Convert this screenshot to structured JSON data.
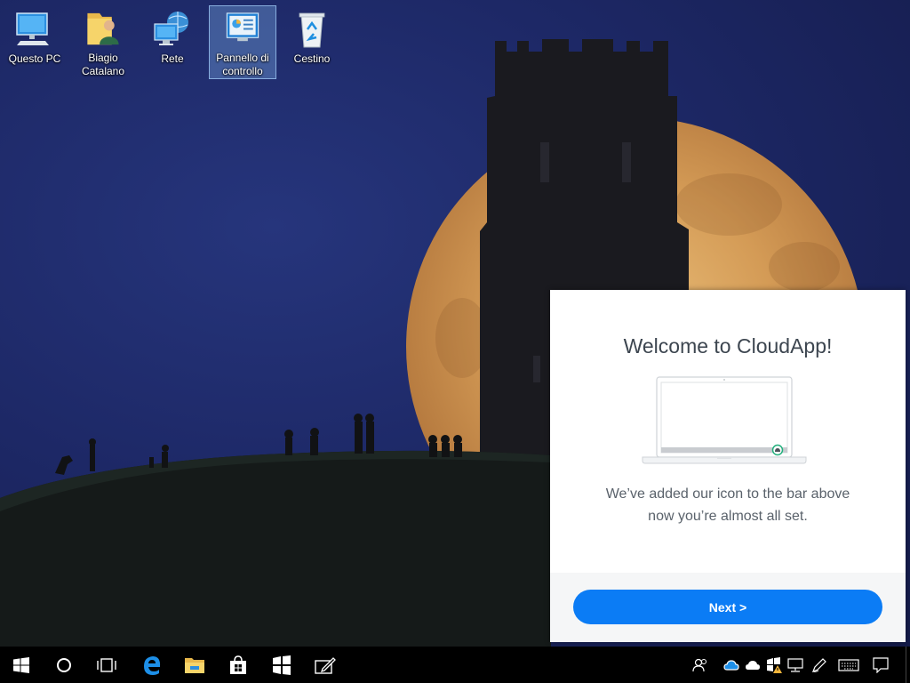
{
  "desktop": {
    "icons": [
      {
        "label": "Questo PC",
        "icon": "computer-icon"
      },
      {
        "label": "Biagio Catalano",
        "icon": "user-folder-icon"
      },
      {
        "label": "Rete",
        "icon": "network-icon"
      },
      {
        "label": "Pannello di controllo",
        "icon": "control-panel-icon",
        "selected": true
      },
      {
        "label": "Cestino",
        "icon": "recycle-bin-icon"
      }
    ]
  },
  "welcome": {
    "title": "Welcome to CloudApp!",
    "line1": "We’ve added our icon to the bar above",
    "line2": "now you’re almost all set.",
    "next_label": "Next >",
    "accent": "#0b7cf5"
  },
  "taskbar": {
    "buttons": [
      "start-icon",
      "cortana-icon",
      "task-view-icon",
      "edge-icon",
      "file-explorer-icon",
      "store-icon",
      "windows-app-icon",
      "sketch-icon"
    ],
    "tray": [
      "people-icon",
      "cloudapp-tray-icon",
      "onedrive-icon",
      "defender-icon",
      "network-tray-icon",
      "pen-icon",
      "keyboard-icon",
      "action-center-icon"
    ]
  },
  "colors": {
    "taskbar": "#000000",
    "selection": "#78aae6",
    "sky": "#1d2866",
    "moon": "#d9a35c"
  }
}
